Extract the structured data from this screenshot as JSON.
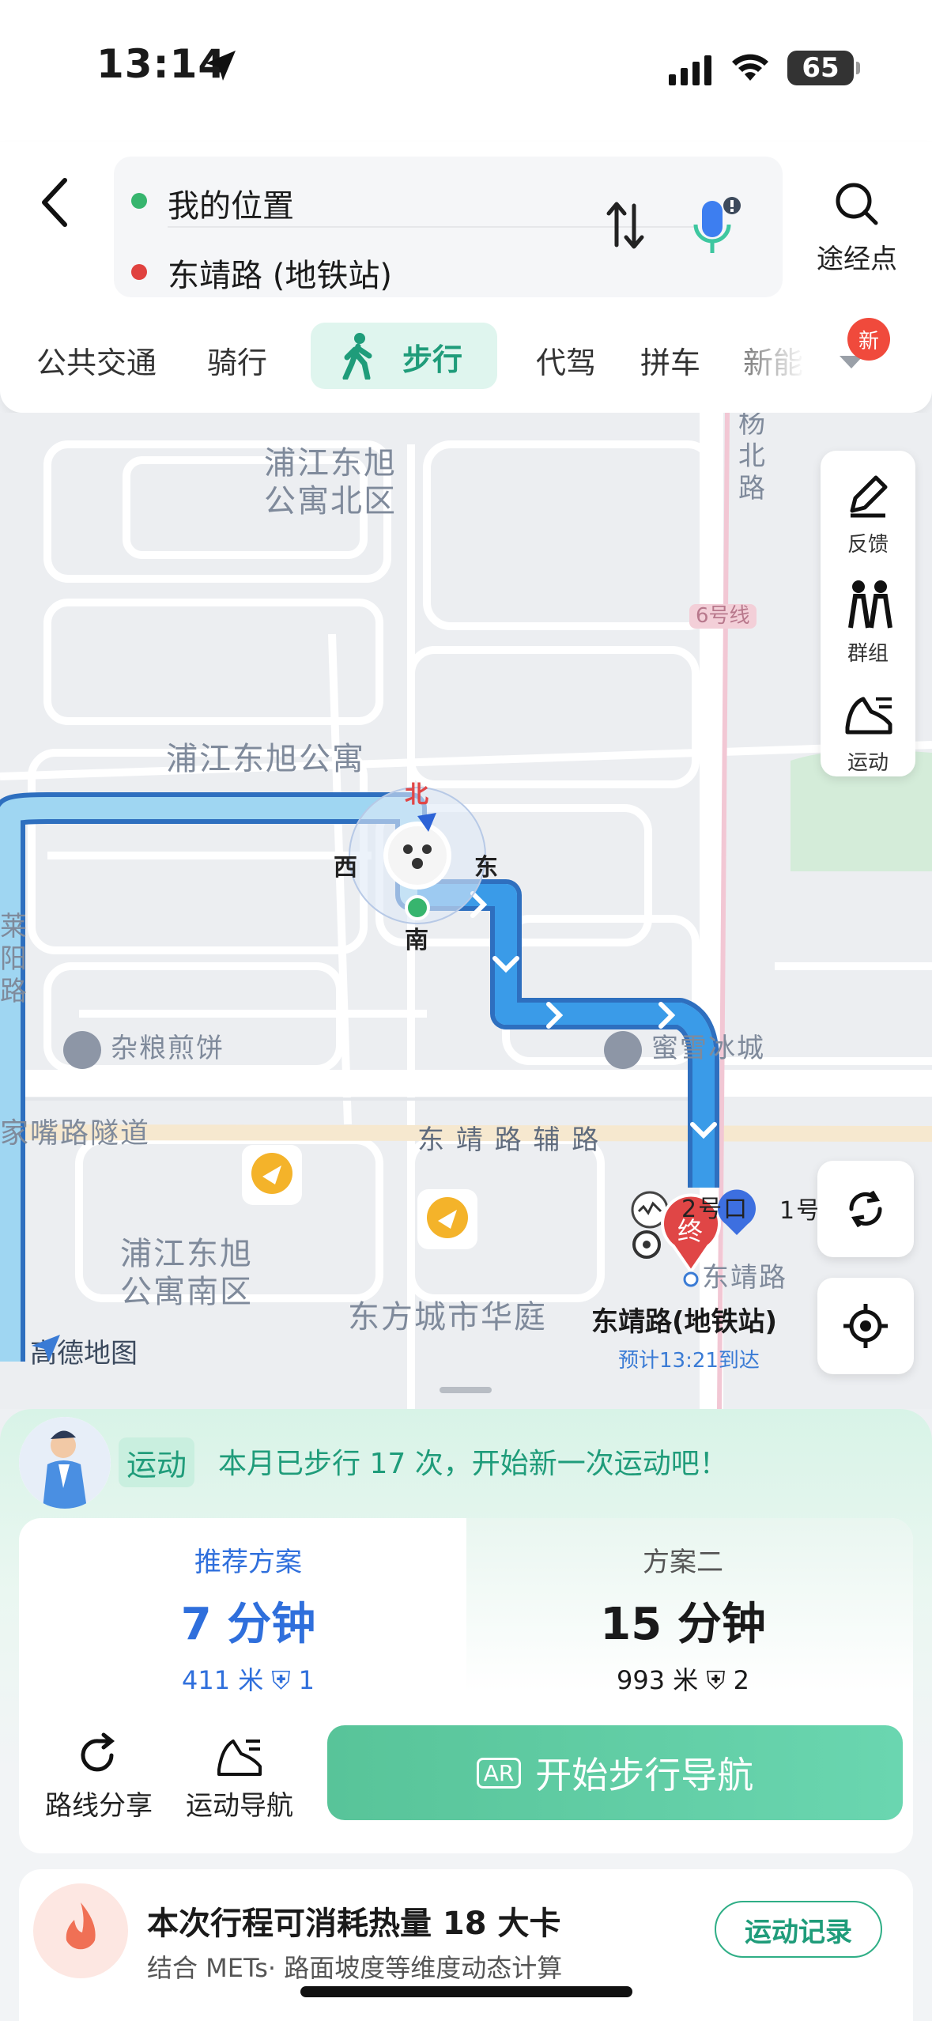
{
  "status_bar": {
    "time": "13:14",
    "battery": "65"
  },
  "route": {
    "from": "我的位置",
    "to": "东靖路 (地铁站)",
    "waypoint_label": "途经点"
  },
  "modes": {
    "transit": "公共交通",
    "bike": "骑行",
    "walk": "步行",
    "driver": "代驾",
    "carpool": "拼车",
    "new_energy": "新能",
    "new_badge": "新",
    "active": "步行"
  },
  "map": {
    "labels": {
      "poi_apt_north": "浦江东旭\n公寓北区",
      "poi_apt": "浦江东旭公寓",
      "poi_apt_south": "浦江东旭\n公寓南区",
      "poi_huating": "东方城市华庭",
      "road_yang": "杨\n北\n路",
      "road_lai": "莱\n阳\n路",
      "road_tunnel": "家嘴路隧道",
      "road_fu": "东 靖 路 辅 路",
      "metro_line": "6号线",
      "food": "杂粮煎饼",
      "mixue": "蜜雪冰城",
      "exit2": "2号口",
      "exit1": "1号",
      "station_small": "东靖路",
      "end_marker": "终"
    },
    "compass": {
      "n": "北",
      "s": "南",
      "w": "西",
      "e": "东"
    },
    "destination": "东靖路(地铁站)",
    "eta": "预计13:21到达",
    "logo": "高德地图",
    "side_panel": {
      "feedback": "反馈",
      "group": "群组",
      "sport": "运动"
    }
  },
  "sheet": {
    "sport_tag": "运动",
    "sport_msg": "本月已步行 17 次，开始新一次运动吧！",
    "plan1": {
      "name": "推荐方案",
      "time": "7 分钟",
      "meta": "411 米  ⛨ 1"
    },
    "plan2": {
      "name": "方案二",
      "time": "15 分钟",
      "meta": "993 米  ⛨ 2"
    },
    "share": "路线分享",
    "sport_nav": "运动导航",
    "start": "开始步行导航",
    "start_icon": "AR",
    "calorie_title": "本次行程可消耗热量 18 大卡",
    "calorie_sub": "结合 METs· 路面坡度等维度动态计算",
    "record": "运动记录"
  },
  "colors": {
    "accent": "#1f9c7a",
    "route": "#3a9be8",
    "plan_blue": "#2f6fdc",
    "start_btn": "#5ecba2"
  }
}
